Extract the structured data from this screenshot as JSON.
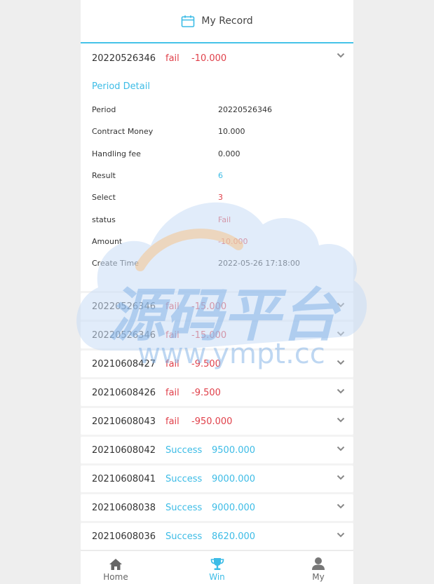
{
  "header": {
    "title": "My Record",
    "icon": "calendar-icon"
  },
  "expanded": {
    "period": "20220526346",
    "status": "fail",
    "amount": "-10.000",
    "detail_title": "Period Detail",
    "rows": [
      {
        "key": "Period",
        "value": "20220526346",
        "tone": "normal"
      },
      {
        "key": "Contract Money",
        "value": "10.000",
        "tone": "normal"
      },
      {
        "key": "Handling fee",
        "value": "0.000",
        "tone": "normal"
      },
      {
        "key": "Result",
        "value": "6",
        "tone": "blue"
      },
      {
        "key": "Select",
        "value": "3",
        "tone": "red"
      },
      {
        "key": "status",
        "value": "Fail",
        "tone": "red"
      },
      {
        "key": "Amount",
        "value": "-10.000",
        "tone": "red"
      },
      {
        "key": "Create Time",
        "value": "2022-05-26 17:18:00",
        "tone": "normal"
      }
    ]
  },
  "records": [
    {
      "period": "20220526346",
      "status": "fail",
      "amount": "-15.000",
      "tone": "red"
    },
    {
      "period": "20220526346",
      "status": "fail",
      "amount": "-15.000",
      "tone": "red"
    },
    {
      "period": "20210608427",
      "status": "fail",
      "amount": "-9.500",
      "tone": "red"
    },
    {
      "period": "20210608426",
      "status": "fail",
      "amount": "-9.500",
      "tone": "red"
    },
    {
      "period": "20210608043",
      "status": "fail",
      "amount": "-950.000",
      "tone": "red"
    },
    {
      "period": "20210608042",
      "status": "Success",
      "amount": "9500.000",
      "tone": "blue"
    },
    {
      "period": "20210608041",
      "status": "Success",
      "amount": "9000.000",
      "tone": "blue"
    },
    {
      "period": "20210608038",
      "status": "Success",
      "amount": "9000.000",
      "tone": "blue"
    },
    {
      "period": "20210608036",
      "status": "Success",
      "amount": "8620.000",
      "tone": "blue"
    }
  ],
  "tabbar": {
    "home": "Home",
    "win": "Win",
    "my": "My",
    "active": "win"
  },
  "watermark": {
    "text_cn": "源码平台",
    "text_url": "www.ympt.cc"
  },
  "colors": {
    "accent": "#3dbce6",
    "fail": "#e0404a"
  }
}
